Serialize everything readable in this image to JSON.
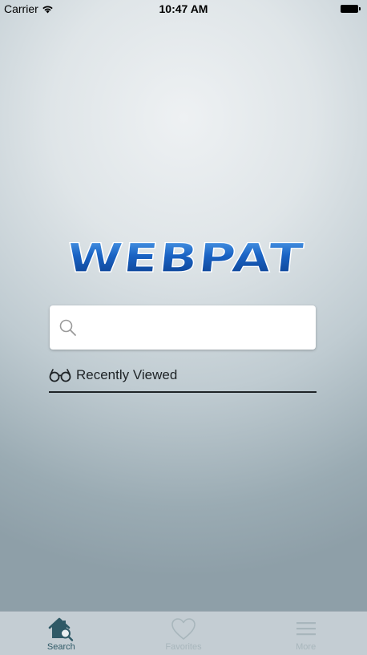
{
  "status_bar": {
    "carrier": "Carrier",
    "time": "10:47 AM"
  },
  "logo": {
    "text": "WEBPAT",
    "colors": [
      "#1a5fb8",
      "#0c3f8c"
    ]
  },
  "search": {
    "placeholder": "",
    "value": "",
    "icon": "search-icon"
  },
  "recently_viewed": {
    "label": "Recently Viewed",
    "icon": "glasses-icon"
  },
  "tab_bar": {
    "tabs": [
      {
        "label": "Search",
        "icon": "home-search-icon",
        "active": true
      },
      {
        "label": "Favorites",
        "icon": "heart-icon",
        "active": false
      },
      {
        "label": "More",
        "icon": "menu-icon",
        "active": false
      }
    ]
  },
  "colors": {
    "accent": "#2f5966",
    "inactive": "#a8b6bc"
  }
}
